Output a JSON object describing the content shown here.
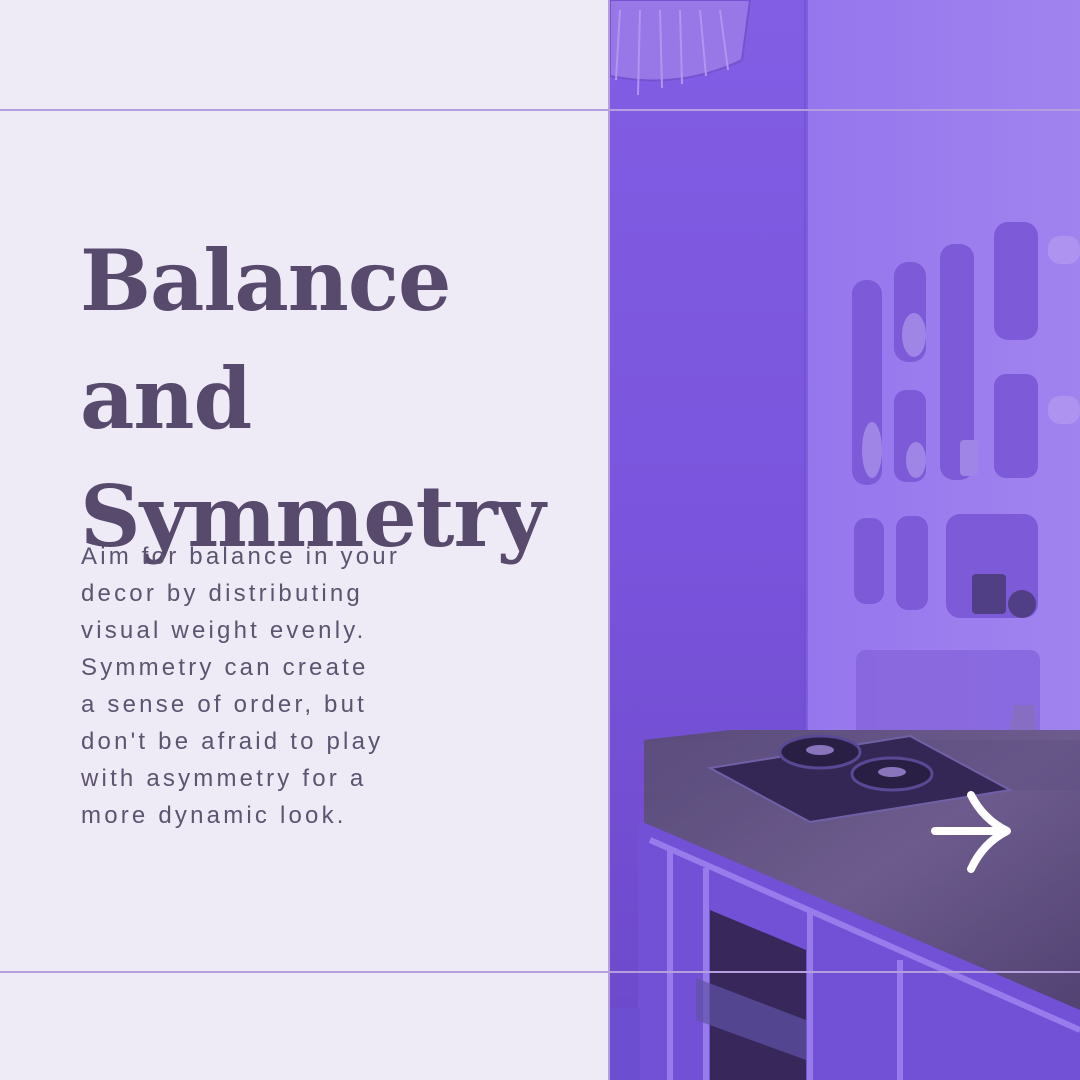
{
  "title_lines": [
    "Balance and",
    "Symmetry"
  ],
  "body_lines": [
    "Aim for balance in your",
    "decor by distributing",
    "visual weight evenly.",
    "Symmetry can create",
    "a sense of order, but",
    "don't be afraid to play",
    "with asymmetry for a",
    "more dynamic look."
  ],
  "colors": {
    "background": "#eeeaf6",
    "title": "#574a6d",
    "body": "#5d5470",
    "guide_lines": "#b49ede",
    "photo_tint": "#7d56e0"
  },
  "next_icon": "arrow-right-icon"
}
